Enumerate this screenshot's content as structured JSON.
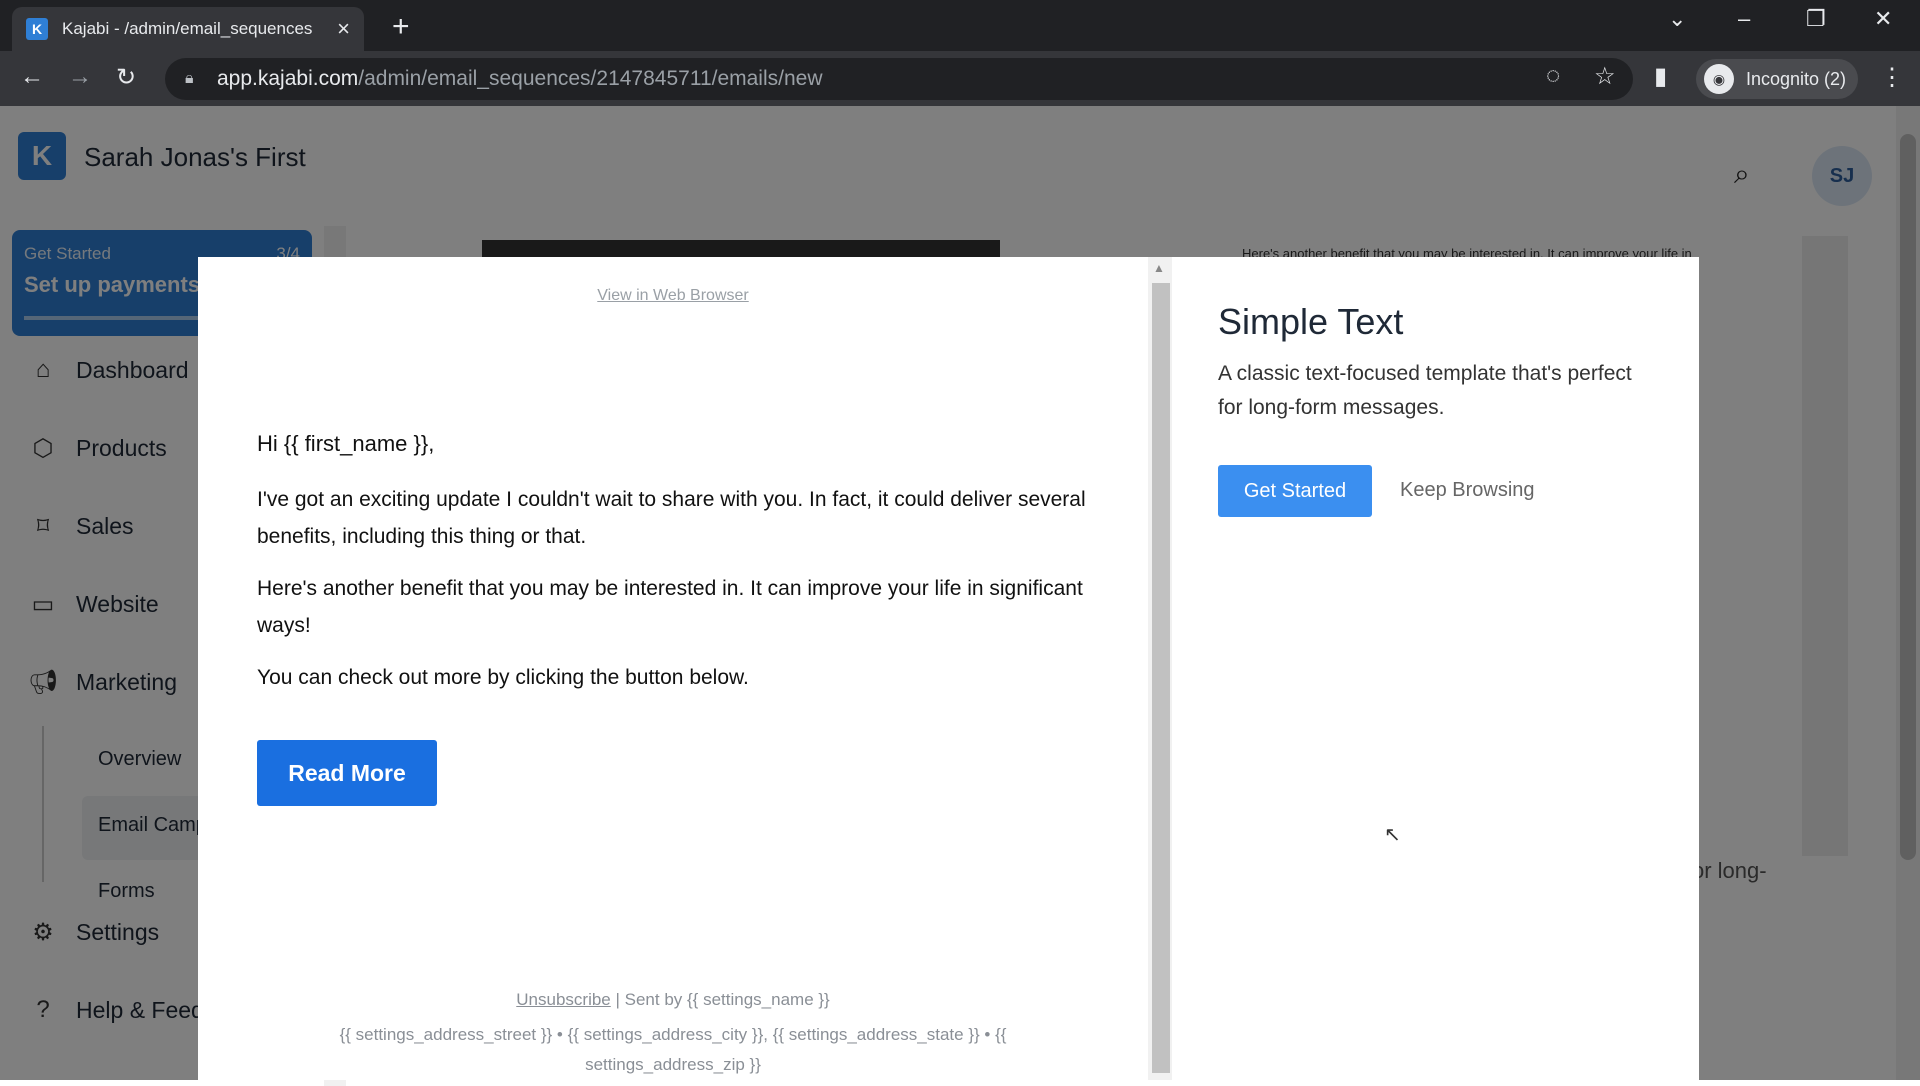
{
  "browser": {
    "tab_title": "Kajabi - /admin/email_sequences",
    "favicon": "K",
    "url_host": "app.kajabi.com",
    "url_path": "/admin/email_sequences/2147845711/emails/new",
    "incognito_label": "Incognito (2)"
  },
  "app": {
    "logo": "K",
    "site_name": "Sarah Jonas's First",
    "avatar_initials": "SJ",
    "get_started": {
      "label": "Get Started",
      "count": "3/4",
      "title": "Set up payments"
    },
    "sidebar": {
      "items": [
        {
          "label": "Dashboard"
        },
        {
          "label": "Products"
        },
        {
          "label": "Sales"
        },
        {
          "label": "Website"
        },
        {
          "label": "Marketing"
        },
        {
          "label": "Settings"
        },
        {
          "label": "Help & Feedback"
        }
      ],
      "sub_items": [
        {
          "label": "Overview"
        },
        {
          "label": "Email Campaigns"
        },
        {
          "label": "Forms"
        }
      ]
    },
    "bg_text_right": "Here's another benefit that you may be interested in. It can improve your life in",
    "bg_text_long": "or long-"
  },
  "preview": {
    "view_in_browser": "View in Web Browser",
    "greeting": "Hi {{ first_name }},",
    "para1": "I've got an exciting update I couldn't wait to share with you. In fact, it could deliver several benefits, including this thing or that.",
    "para2": "Here's another benefit that you may be interested in. It can improve your life in significant ways!",
    "para3": "You can check out more by clicking the button below.",
    "button": "Read More",
    "unsubscribe": "Unsubscribe",
    "sent_by": " | Sent by {{ settings_name }}",
    "address": "{{ settings_address_street }} • {{ settings_address_city }}, {{ settings_address_state }} • {{ settings_address_zip }}"
  },
  "template": {
    "title": "Simple Text",
    "description": "A classic text-focused template that's perfect for long-form messages.",
    "get_started": "Get Started",
    "keep_browsing": "Keep Browsing"
  }
}
